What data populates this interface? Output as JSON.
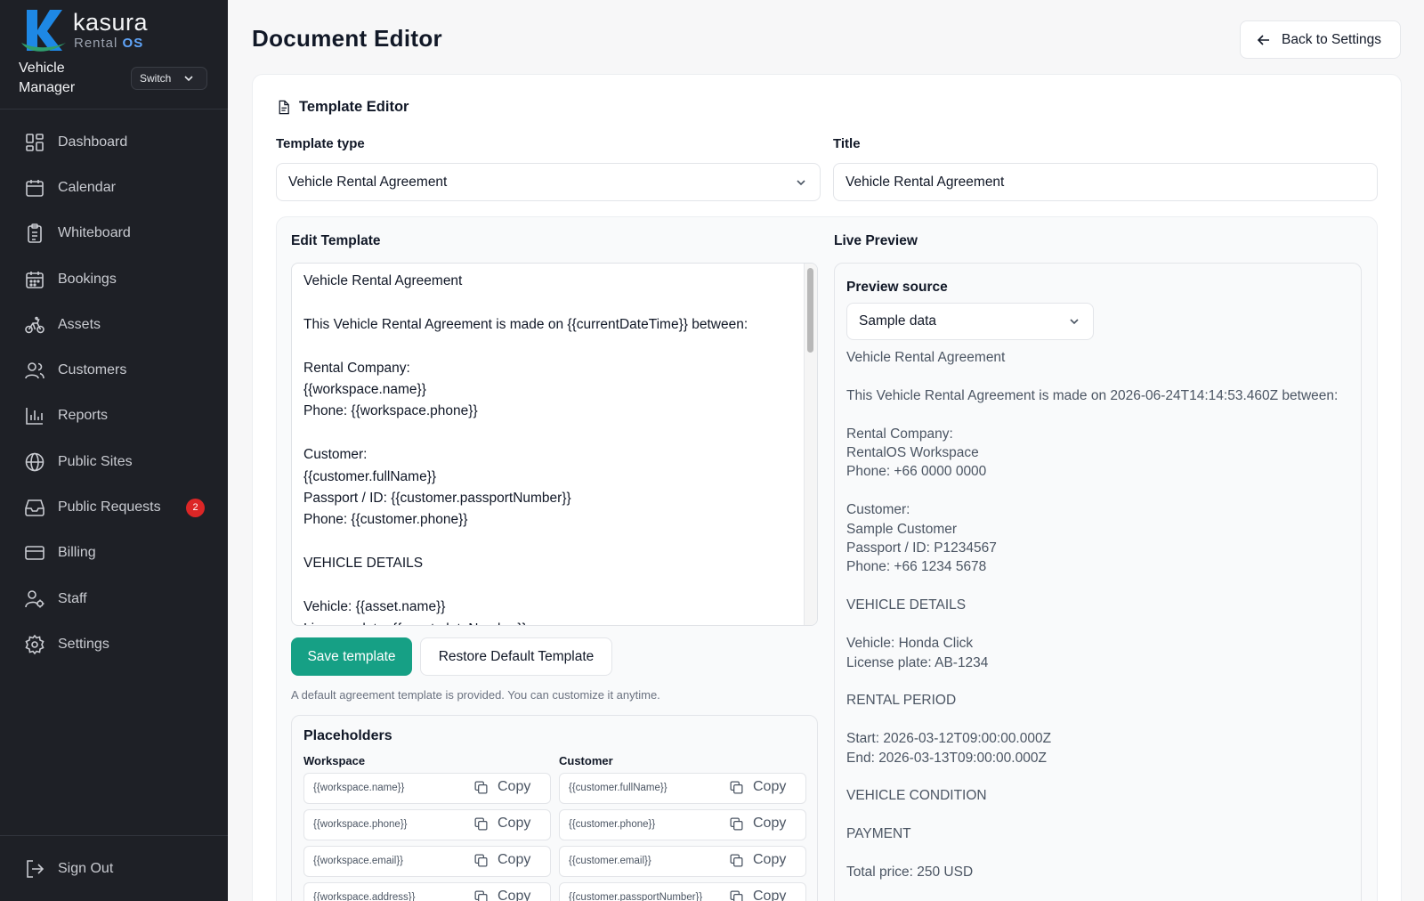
{
  "brand": {
    "name": "kasura",
    "sub_prefix": "Rental",
    "sub_suffix": "OS",
    "accent": "#1e88e5"
  },
  "sidebar": {
    "workspace_name": "Vehicle Manager",
    "switch_label": "Switch",
    "items": [
      {
        "label": "Dashboard",
        "icon": "dashboard-icon"
      },
      {
        "label": "Calendar",
        "icon": "calendar-icon"
      },
      {
        "label": "Whiteboard",
        "icon": "clipboard-icon"
      },
      {
        "label": "Bookings",
        "icon": "bookings-calendar-icon"
      },
      {
        "label": "Assets",
        "icon": "bike-icon"
      },
      {
        "label": "Customers",
        "icon": "users-icon"
      },
      {
        "label": "Reports",
        "icon": "bar-chart-icon"
      },
      {
        "label": "Public Sites",
        "icon": "globe-icon"
      },
      {
        "label": "Public Requests",
        "icon": "inbox-icon",
        "badge": "2"
      },
      {
        "label": "Billing",
        "icon": "credit-card-icon"
      },
      {
        "label": "Staff",
        "icon": "user-cog-icon"
      },
      {
        "label": "Settings",
        "icon": "gear-icon"
      }
    ],
    "sign_out": "Sign Out"
  },
  "header": {
    "title": "Document Editor",
    "back_label": "Back to Settings"
  },
  "editor_card": {
    "heading": "Template Editor",
    "template_type_label": "Template type",
    "template_type_value": "Vehicle Rental Agreement",
    "title_label": "Title",
    "title_value": "Vehicle Rental Agreement",
    "edit_label": "Edit Template",
    "template_text": "Vehicle Rental Agreement\n\nThis Vehicle Rental Agreement is made on {{currentDateTime}} between:\n\nRental Company:\n{{workspace.name}}\nPhone: {{workspace.phone}}\n\nCustomer:\n{{customer.fullName}}\nPassport / ID: {{customer.passportNumber}}\nPhone: {{customer.phone}}\n\nVEHICLE DETAILS\n\nVehicle: {{asset.name}}\nLicense plate: {{asset.plateNumber}}",
    "save_label": "Save template",
    "restore_label": "Restore Default Template",
    "hint": "A default agreement template is provided. You can customize it anytime.",
    "save_color": "#16a085"
  },
  "placeholders": {
    "title": "Placeholders",
    "copy_label": "Copy",
    "workspace_label": "Workspace",
    "customer_label": "Customer",
    "workspace": [
      "{{workspace.name}}",
      "{{workspace.phone}}",
      "{{workspace.email}}",
      "{{workspace.address}}"
    ],
    "customer": [
      "{{customer.fullName}}",
      "{{customer.phone}}",
      "{{customer.email}}",
      "{{customer.passportNumber}}"
    ]
  },
  "preview": {
    "label": "Live Preview",
    "source_label": "Preview source",
    "source_value": "Sample data",
    "text": "Vehicle Rental Agreement\n\nThis Vehicle Rental Agreement is made on 2026-06-24T14:14:53.460Z between:\n\nRental Company:\nRentalOS Workspace\nPhone: +66 0000 0000\n\nCustomer:\nSample Customer\nPassport / ID: P1234567\nPhone: +66 1234 5678\n\nVEHICLE DETAILS\n\nVehicle: Honda Click\nLicense plate: AB-1234\n\nRENTAL PERIOD\n\nStart: 2026-03-12T09:00:00.000Z\nEnd: 2026-03-13T09:00:00.000Z\n\nVEHICLE CONDITION\n\nPAYMENT\n\nTotal price: 250 USD"
  }
}
